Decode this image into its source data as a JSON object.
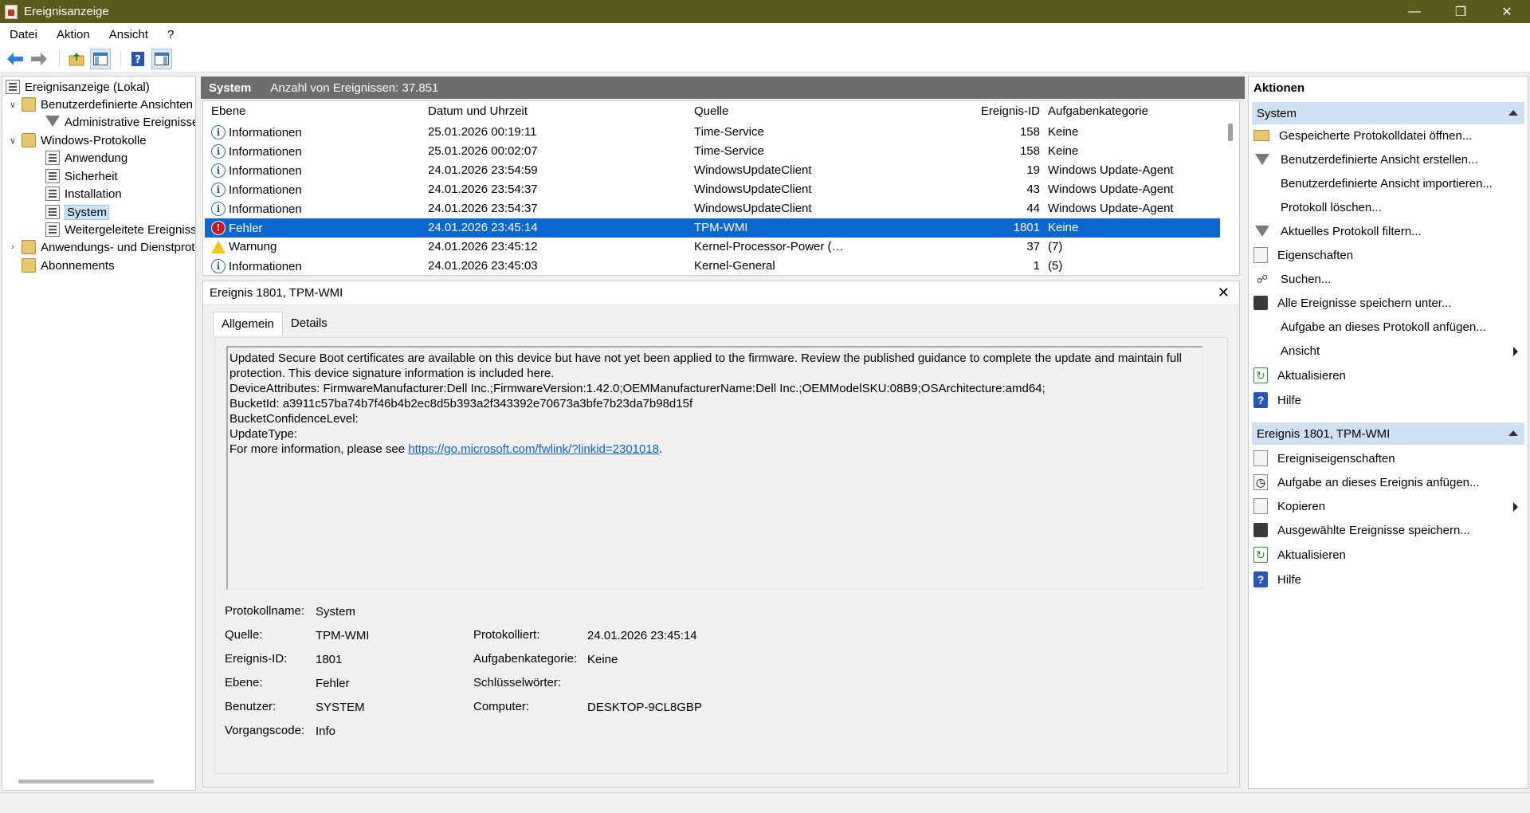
{
  "window": {
    "title": "Ereignisanzeige"
  },
  "menu": [
    "Datei",
    "Aktion",
    "Ansicht",
    "?"
  ],
  "tree": {
    "root": "Ereignisanzeige (Lokal)",
    "custom_views": "Benutzerdefinierte Ansichten",
    "admin_events": "Administrative Ereignisse",
    "windows_logs": "Windows-Protokolle",
    "application": "Anwendung",
    "security": "Sicherheit",
    "setup": "Installation",
    "system": "System",
    "forwarded": "Weitergeleitete Ereignisse",
    "apps_services": "Anwendungs- und Dienstprotokolle",
    "subscriptions": "Abonnements"
  },
  "center": {
    "log_name": "System",
    "event_count": "Anzahl von Ereignissen: 37.851",
    "columns": [
      "Ebene",
      "Datum und Uhrzeit",
      "Quelle",
      "Ereignis-ID",
      "Aufgabenkategorie"
    ],
    "rows": [
      {
        "level": "Informationen",
        "level_type": "info",
        "date": "25.01.2026 00:19:11",
        "source": "Time-Service",
        "id": "158",
        "category": "Keine"
      },
      {
        "level": "Informationen",
        "level_type": "info",
        "date": "25.01.2026 00:02:07",
        "source": "Time-Service",
        "id": "158",
        "category": "Keine"
      },
      {
        "level": "Informationen",
        "level_type": "info",
        "date": "24.01.2026 23:54:59",
        "source": "WindowsUpdateClient",
        "id": "19",
        "category": "Windows Update-Agent"
      },
      {
        "level": "Informationen",
        "level_type": "info",
        "date": "24.01.2026 23:54:37",
        "source": "WindowsUpdateClient",
        "id": "43",
        "category": "Windows Update-Agent"
      },
      {
        "level": "Informationen",
        "level_type": "info",
        "date": "24.01.2026 23:54:37",
        "source": "WindowsUpdateClient",
        "id": "44",
        "category": "Windows Update-Agent"
      },
      {
        "level": "Fehler",
        "level_type": "error",
        "date": "24.01.2026 23:45:14",
        "source": "TPM-WMI",
        "id": "1801",
        "category": "Keine",
        "selected": true
      },
      {
        "level": "Warnung",
        "level_type": "warn",
        "date": "24.01.2026 23:45:12",
        "source": "Kernel-Processor-Power (Micr...",
        "id": "37",
        "category": "(7)"
      },
      {
        "level": "Informationen",
        "level_type": "info",
        "date": "24.01.2026 23:45:03",
        "source": "Kernel-General",
        "id": "1",
        "category": "(5)"
      }
    ]
  },
  "detail": {
    "title": "Ereignis 1801, TPM-WMI",
    "tabs": [
      "Allgemein",
      "Details"
    ],
    "message_lines": [
      "Updated Secure Boot certificates are available on this device but have not yet been applied to the firmware. Review the published guidance to complete the update and maintain full",
      "protection. This device signature information is included here.",
      "DeviceAttributes: FirmwareManufacturer:Dell Inc.;FirmwareVersion:1.42.0;OEMManufacturerName:Dell Inc.;OEMModelSKU:08B9;OSArchitecture:amd64;",
      "BucketId: a3911c57ba74b7f46b4b2ec8d5b393a2f343392e70673a3bfe7b23da7b98d15f",
      "BucketConfidenceLevel:",
      "UpdateType:"
    ],
    "more_info_prefix": "For more information, please see ",
    "more_info_link": "https://go.microsoft.com/fwlink/?linkid=2301018",
    "more_info_suffix": ".",
    "props": {
      "log_name_label": "Protokollname:",
      "log_name": "System",
      "source_label": "Quelle:",
      "source": "TPM-WMI",
      "logged_label": "Protokolliert:",
      "logged": "24.01.2026 23:45:14",
      "event_id_label": "Ereignis-ID:",
      "event_id": "1801",
      "task_cat_label": "Aufgabenkategorie:",
      "task_cat": "Keine",
      "level_label": "Ebene:",
      "level": "Fehler",
      "keywords_label": "Schlüsselwörter:",
      "user_label": "Benutzer:",
      "user": "SYSTEM",
      "computer_label": "Computer:",
      "computer": "DESKTOP-9CL8GBP",
      "opcode_label": "Vorgangscode:",
      "opcode": "Info"
    }
  },
  "actions": {
    "title": "Aktionen",
    "group1": "System",
    "group1_items": [
      {
        "label": "Gespeicherte Protokolldatei öffnen...",
        "icon": "folder-open-icon"
      },
      {
        "label": "Benutzerdefinierte Ansicht erstellen...",
        "icon": "filter-icon"
      },
      {
        "label": "Benutzerdefinierte Ansicht importieren...",
        "icon": ""
      },
      {
        "label": "Protokoll löschen...",
        "icon": ""
      },
      {
        "label": "Aktuelles Protokoll filtern...",
        "icon": "filter-icon"
      },
      {
        "label": "Eigenschaften",
        "icon": "properties-icon"
      },
      {
        "label": "Suchen...",
        "icon": "binoculars-icon"
      },
      {
        "label": "Alle Ereignisse speichern unter...",
        "icon": "save-icon"
      },
      {
        "label": "Aufgabe an dieses Protokoll anfügen...",
        "icon": ""
      },
      {
        "label": "Ansicht",
        "icon": ""
      },
      {
        "label": "Aktualisieren",
        "icon": "refresh-icon"
      },
      {
        "label": "Hilfe",
        "icon": "help-icon"
      }
    ],
    "group2": "Ereignis 1801, TPM-WMI",
    "group2_items": [
      {
        "label": "Ereigniseigenschaften",
        "icon": "properties-icon"
      },
      {
        "label": "Aufgabe an dieses Ereignis anfügen...",
        "icon": "task-icon"
      },
      {
        "label": "Kopieren",
        "icon": "copy-icon"
      },
      {
        "label": "Ausgewählte Ereignisse speichern...",
        "icon": "save-icon"
      },
      {
        "label": "Aktualisieren",
        "icon": "refresh-icon"
      },
      {
        "label": "Hilfe",
        "icon": "help-icon"
      }
    ]
  }
}
